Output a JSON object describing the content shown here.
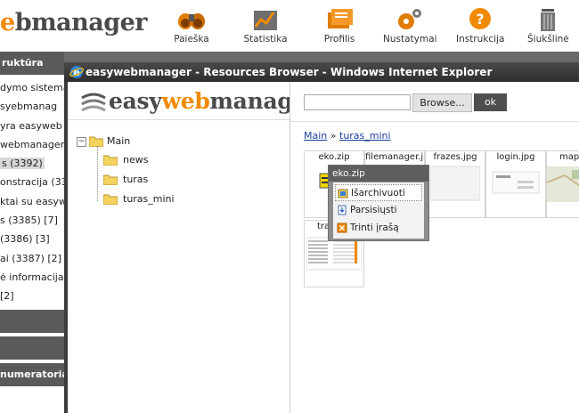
{
  "app": {
    "logo_partial": "eb",
    "logo_accent": "",
    "logo_rest": "manager",
    "logo_text": "webmanager"
  },
  "nav": [
    {
      "label": "Paieška",
      "icon": "binoculars-icon"
    },
    {
      "label": "Statistika",
      "icon": "chart-icon"
    },
    {
      "label": "Profilis",
      "icon": "profile-icon"
    },
    {
      "label": "Nustatymai",
      "icon": "gears-icon"
    },
    {
      "label": "Instrukcija",
      "icon": "help-icon"
    },
    {
      "label": "Šiukšlinė",
      "icon": "trash-icon"
    }
  ],
  "left_panel": {
    "header": "ruktūra",
    "items": [
      "dymo sistema",
      "syebmanag",
      "yra easyweb",
      "webmanager",
      "s (3392)",
      "onstracija (33",
      "ktai su easyw",
      "s (3385) [7]",
      "(3386) [3]",
      "ai (3387) [2]",
      "ė informacija",
      "[2]"
    ],
    "bar2": "",
    "bar3": "",
    "bar4": "numeratoria"
  },
  "window": {
    "title": "easywebmanager - Resources Browser - Windows Internet Explorer",
    "inner_logo": "easywebmanager"
  },
  "tree": {
    "root": "Main",
    "children": [
      "news",
      "turas",
      "turas_mini"
    ]
  },
  "toolbar": {
    "upload_value": "",
    "browse_label": "Browse...",
    "ok_label": "ok"
  },
  "breadcrumb": {
    "root": "Main",
    "sep": "»",
    "current": "turas_mini"
  },
  "files": [
    {
      "name": "eko.zip"
    },
    {
      "name": "filemanager.jpg"
    },
    {
      "name": "frazes.jpg"
    },
    {
      "name": "login.jpg"
    },
    {
      "name": "map.jpg"
    },
    {
      "name": "tra"
    }
  ],
  "context_menu": {
    "title": "eko.zip",
    "items": [
      "Išarchivuoti",
      "Parsisiųsti",
      "Trinti įrašą"
    ]
  },
  "colors": {
    "accent": "#f18a00",
    "dark_bar": "#5a5a5a",
    "link": "#1a3f9e"
  }
}
